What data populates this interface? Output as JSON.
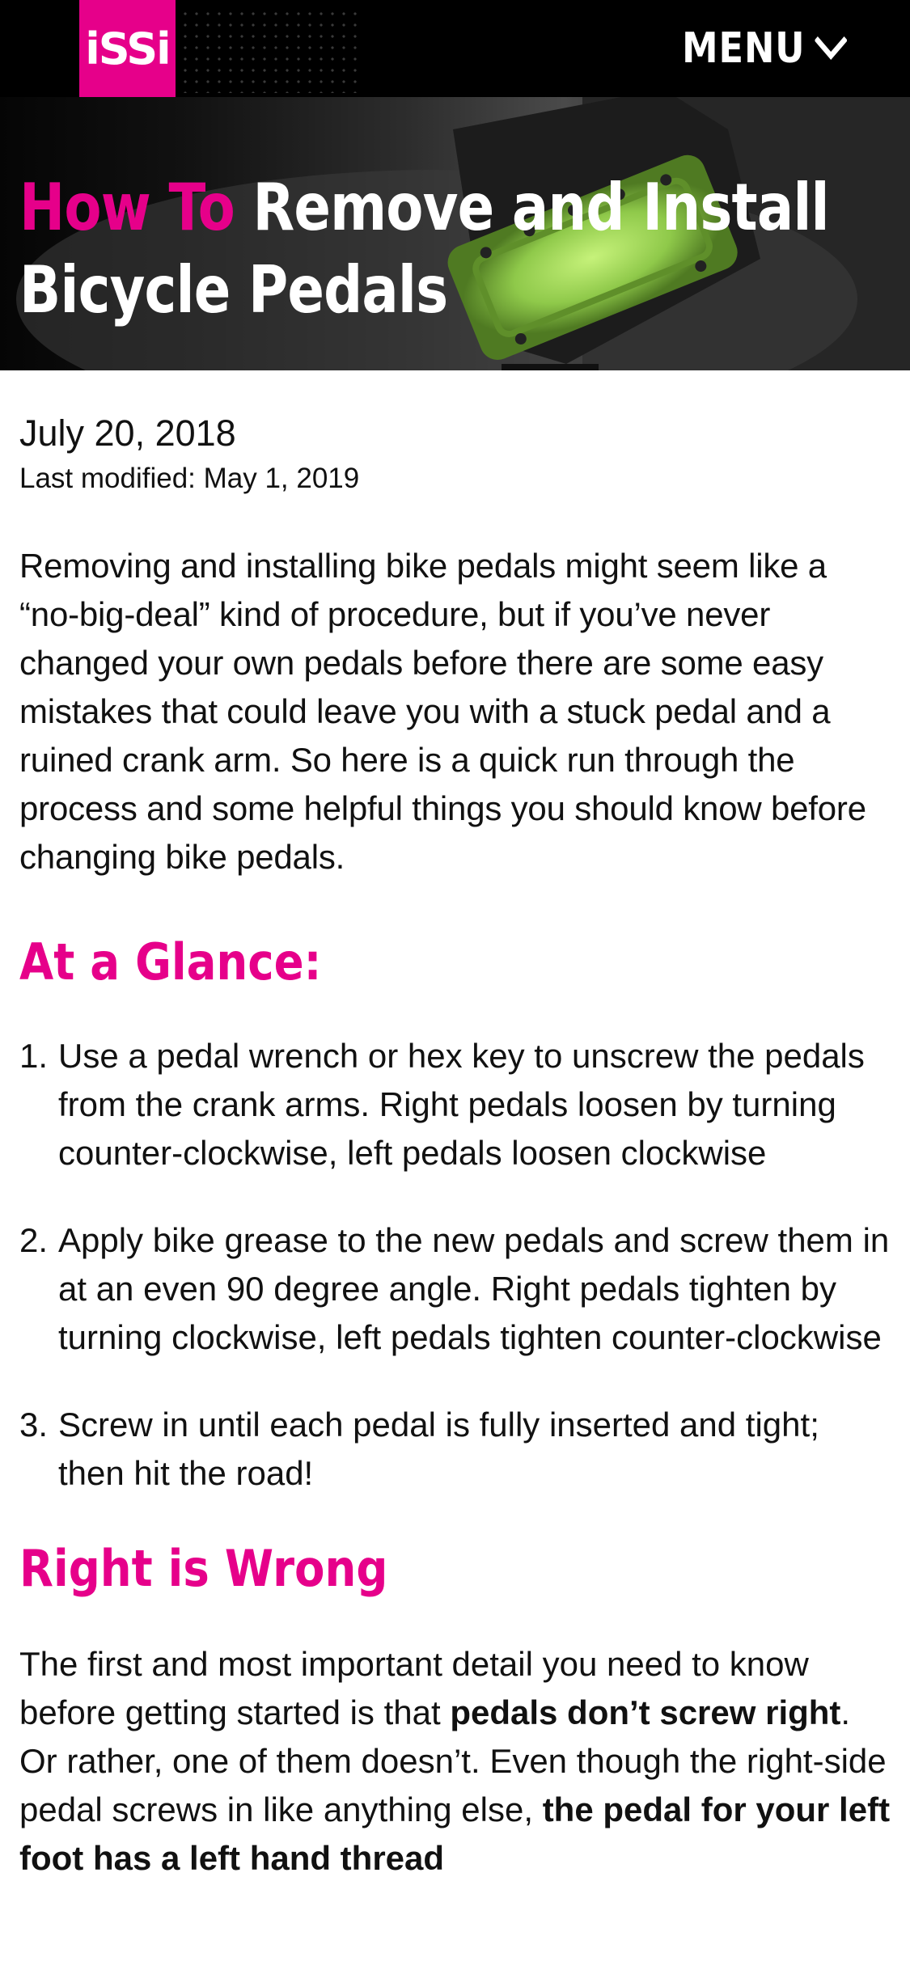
{
  "header": {
    "logo_text": "iSSi",
    "menu_label": "MENU",
    "brand_color": "#e6008a"
  },
  "hero": {
    "title_prefix": "How To",
    "title_line1_rest": " Remove and Install",
    "title_line2": "Bicycle Pedals"
  },
  "article": {
    "date": "July 20, 2018",
    "last_modified": "Last modified: May 1, 2019",
    "intro": "Removing and installing bike pedals might seem like a “no-big-deal” kind of procedure, but if you’ve never changed your own pedals before there are some easy mistakes that could leave you with a stuck pedal and a ruined crank arm. So here is a quick run through the process and some helpful things you should know before changing bike pedals.",
    "glance_heading": "At a Glance:",
    "steps": [
      {
        "num": "1.",
        "text": "Use a pedal wrench or hex key to unscrew the pedals from the crank arms. Right pedals loosen by turning counter-clockwise, left pedals loosen clockwise"
      },
      {
        "num": "2.",
        "text": "Apply bike grease to the new pedals and screw them in at an even 90 degree angle. Right pedals tighten by turning clockwise, left pedals tighten counter-clockwise"
      },
      {
        "num": "3.",
        "text": "Screw in until each pedal is fully inserted and tight; then hit the road!"
      }
    ],
    "right_heading": "Right is Wrong",
    "p2_part1": "The first and most important detail you need to know before getting started is that ",
    "p2_bold1": "pedals don’t screw right",
    "p2_part2": ". Or rather, one of them doesn’t. Even though the right-side pedal screws in like anything else, ",
    "p2_bold2": "the pedal for your left foot has a left hand thread"
  }
}
